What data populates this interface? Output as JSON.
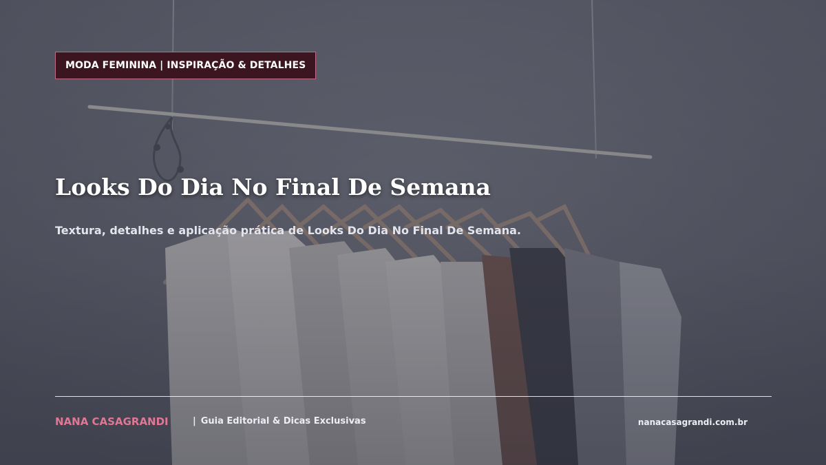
{
  "category_badge": "MODA FEMININA | INSPIRAÇÃO & DETALHES",
  "title": "Looks Do Dia No Final De Semana",
  "subtitle": "Textura, detalhes e aplicação prática de Looks Do Dia No Final De Semana.",
  "footer": {
    "brand": "NANA CASAGRANDI",
    "separator": "|",
    "tagline": "Guia Editorial & Dicas Exclusivas",
    "site": "nanacasagrandi.com.br"
  },
  "background_image": "clothes-rack-photo",
  "colors": {
    "badge_bg": "#3b1620",
    "badge_border": "#c06a86",
    "brand": "#e07895",
    "text": "#ffffff"
  }
}
